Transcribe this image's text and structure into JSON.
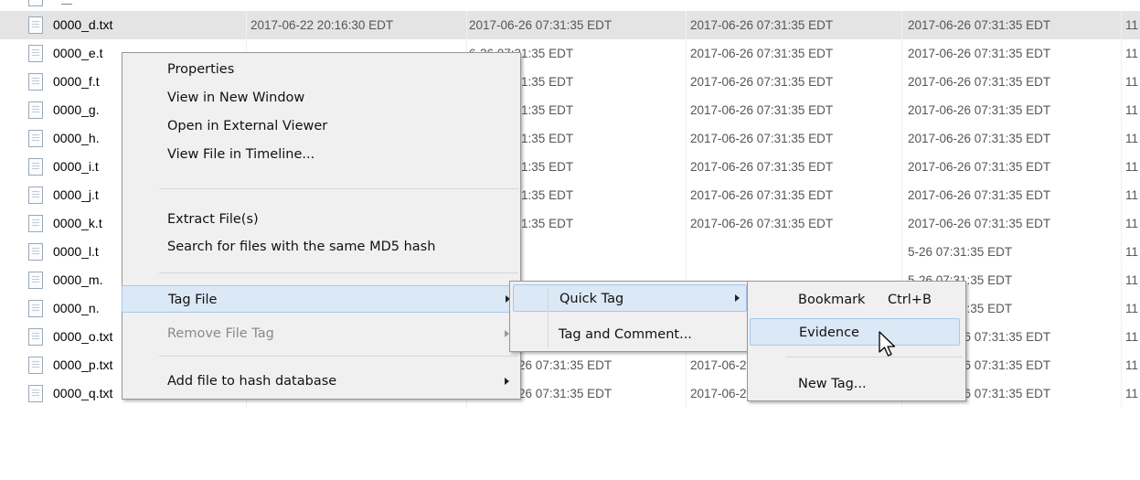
{
  "table": {
    "rows": [
      {
        "name": "0000_d.txt",
        "c1": "2017-06-22 20:16:30 EDT",
        "c2": "2017-06-26 07:31:35 EDT",
        "c3": "2017-06-26 07:31:35 EDT",
        "c4": "2017-06-26 07:31:35 EDT",
        "c5": "11"
      },
      {
        "name": "0000_e.t",
        "c1": "",
        "c2": "6-26 07:31:35 EDT",
        "c3": "2017-06-26 07:31:35 EDT",
        "c4": "2017-06-26 07:31:35 EDT",
        "c5": "11"
      },
      {
        "name": "0000_f.t",
        "c1": "",
        "c2": "6-26 07:31:35 EDT",
        "c3": "2017-06-26 07:31:35 EDT",
        "c4": "2017-06-26 07:31:35 EDT",
        "c5": "11"
      },
      {
        "name": "0000_g.",
        "c1": "",
        "c2": "6-26 07:31:35 EDT",
        "c3": "2017-06-26 07:31:35 EDT",
        "c4": "2017-06-26 07:31:35 EDT",
        "c5": "11"
      },
      {
        "name": "0000_h.",
        "c1": "",
        "c2": "6-26 07:31:35 EDT",
        "c3": "2017-06-26 07:31:35 EDT",
        "c4": "2017-06-26 07:31:35 EDT",
        "c5": "11"
      },
      {
        "name": "0000_i.t",
        "c1": "",
        "c2": "6-26 07:31:35 EDT",
        "c3": "2017-06-26 07:31:35 EDT",
        "c4": "2017-06-26 07:31:35 EDT",
        "c5": "11"
      },
      {
        "name": "0000_j.t",
        "c1": "",
        "c2": "6-26 07:31:35 EDT",
        "c3": "2017-06-26 07:31:35 EDT",
        "c4": "2017-06-26 07:31:35 EDT",
        "c5": "11"
      },
      {
        "name": "0000_k.t",
        "c1": "",
        "c2": "6-26 07:31:35 EDT",
        "c3": "2017-06-26 07:31:35 EDT",
        "c4": "2017-06-26 07:31:35 EDT",
        "c5": "11"
      },
      {
        "name": "0000_l.t",
        "c1": "",
        "c2": "",
        "c3": "",
        "c4": "5-26 07:31:35 EDT",
        "c5": "11"
      },
      {
        "name": "0000_m.",
        "c1": "",
        "c2": "",
        "c3": "",
        "c4": "5-26 07:31:35 EDT",
        "c5": "11"
      },
      {
        "name": "0000_n.",
        "c1": "",
        "c2": "6-26 07:31:35 EDT",
        "c3": "2017-06",
        "c4": "5-26 07:31:35 EDT",
        "c5": "11"
      },
      {
        "name": "0000_o.txt",
        "c1": "2017-06-22 20:16:32 EDT",
        "c2": "2017-06-26 07:31:35 EDT",
        "c3": "2017-06-26 07:31:35 EDT",
        "c4": "2017-06-26 07:31:35 EDT",
        "c5": "11"
      },
      {
        "name": "0000_p.txt",
        "c1": "2017-06-22 20:16:32 EDT",
        "c2": "2017-06-26 07:31:35 EDT",
        "c3": "2017-06-26 07:31:35 EDT",
        "c4": "2017-06-26 07:31:35 EDT",
        "c5": "11"
      },
      {
        "name": "0000_q.txt",
        "c1": "2017-06-22 20:16:32 EDT",
        "c2": "2017-06-26 07:31:35 EDT",
        "c3": "2017-06-26 07:31:35 EDT",
        "c4": "2017-06-26 07:31:35 EDT",
        "c5": "11"
      }
    ],
    "selected_row": "0000_d.txt"
  },
  "context_menu": {
    "properties": "Properties",
    "view_new_window": "View in New Window",
    "open_external": "Open in External Viewer",
    "view_timeline": "View File in Timeline...",
    "extract": "Extract File(s)",
    "search_md5": "Search for files with the same MD5 hash",
    "tag_file": "Tag File",
    "remove_tag": "Remove File Tag",
    "add_hash_db": "Add file to hash database"
  },
  "tag_submenu": {
    "quick_tag": "Quick Tag",
    "tag_and_comment": "Tag and Comment..."
  },
  "quick_tag_submenu": {
    "bookmark": "Bookmark",
    "bookmark_shortcut": "Ctrl+B",
    "evidence": "Evidence",
    "new_tag": "New Tag..."
  },
  "icons": {
    "file": "text-file-icon",
    "submenu": "chevron-right-icon",
    "cursor": "mouse-pointer-icon"
  },
  "colors": {
    "selected_row": "#e4e4e4",
    "menu_background": "#f0f0f0",
    "menu_highlight": "#dbe8f6",
    "menu_highlight_border": "#a8c8ec",
    "disabled_text": "#8a8a8a"
  }
}
